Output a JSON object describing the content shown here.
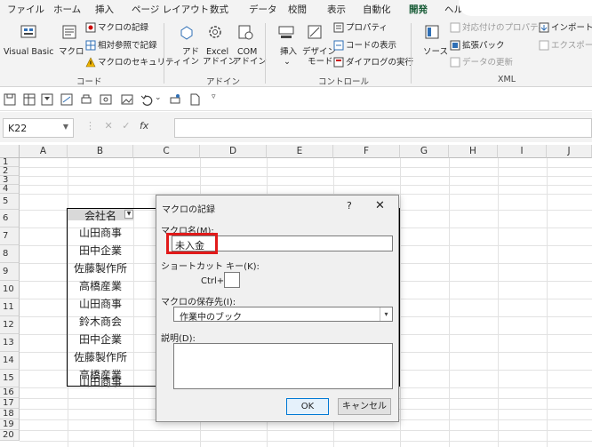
{
  "ribbon_tabs": [
    "ファイル",
    "ホーム",
    "挿入",
    "ページ レイアウト",
    "数式",
    "データ",
    "校閲",
    "表示",
    "自動化",
    "開発",
    "ヘルプ"
  ],
  "active_tab": "開発",
  "ribbon": {
    "code": {
      "visual_basic": "Visual Basic",
      "macro": "マクロ",
      "record_macro": "マクロの記録",
      "relative_ref": "相対参照で記録",
      "macro_security": "マクロのセキュリティ",
      "group": "コード"
    },
    "addins": {
      "addin": "アド",
      "addin2": "イン",
      "excel": "Excel",
      "excel2": "アドイン",
      "com": "COM",
      "com2": "アドイン",
      "group": "アドイン"
    },
    "controls": {
      "insert": "挿入",
      "design": "デザイン",
      "design2": "モード",
      "properties": "プロパティ",
      "view_code": "コードの表示",
      "run_dialog": "ダイアログの実行",
      "group": "コントロール"
    },
    "xml": {
      "source": "ソース",
      "map_props": "対応付けのプロパティ",
      "ext_pack": "拡張パック",
      "refresh": "データの更新",
      "import": "インポート",
      "export": "エクスポート",
      "group": "XML"
    }
  },
  "formula_bar": {
    "name_box": "K22",
    "fx": "fx",
    "cancel": "✕",
    "enter": "✓"
  },
  "columns": [
    "A",
    "B",
    "C",
    "D",
    "E",
    "F",
    "G",
    "H",
    "I",
    "J"
  ],
  "rows": [
    "1",
    "2",
    "3",
    "4",
    "5",
    "6",
    "7",
    "8",
    "9",
    "10",
    "11",
    "12",
    "13",
    "14",
    "15",
    "16",
    "17",
    "18",
    "19",
    "20"
  ],
  "table": {
    "header": "会社名",
    "values": [
      "山田商事",
      "田中企業",
      "佐藤製作所",
      "高橋産業",
      "山田商事",
      "鈴木商会",
      "田中企業",
      "佐藤製作所",
      "高橋産業",
      "山田商事"
    ]
  },
  "dialog": {
    "title": "マクロの記録",
    "help": "?",
    "close": "✕",
    "macro_name_label": "マクロ名(M):",
    "macro_name_value": "未入金",
    "shortcut_label": "ショートカット キー(K):",
    "ctrl_label": "Ctrl+",
    "store_label": "マクロの保存先(I):",
    "store_value": "作業中のブック",
    "desc_label": "説明(D):",
    "ok": "OK",
    "cancel": "キャンセル"
  },
  "colors": {
    "accent": "#185c37",
    "highlight": "#e11a1a"
  }
}
